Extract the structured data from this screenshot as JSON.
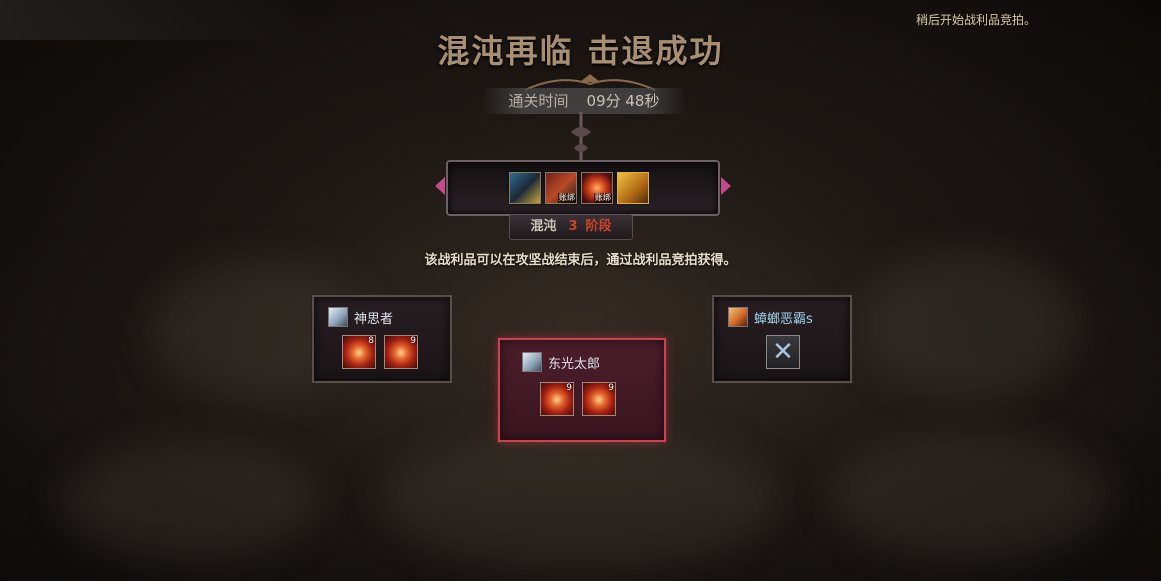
{
  "header": {
    "title_part1": "混沌再临",
    "title_part2": "击退成功",
    "clear_time_label": "通关时间",
    "clear_time_value": "09分 48秒",
    "notice": "稍后开始战利品竞拍。"
  },
  "loot": {
    "items": [
      {
        "icon": "treasure-chest-icon",
        "tag": ""
      },
      {
        "icon": "weapon-box-icon",
        "tag": "账绑"
      },
      {
        "icon": "red-orb-icon",
        "tag": "账绑"
      },
      {
        "icon": "golden-emblem-icon",
        "tag": ""
      }
    ],
    "stage_label": "混沌",
    "stage_number": "3",
    "stage_suffix": "阶段",
    "description": "该战利品可以在攻坚战结束后，通过战利品竞拍获得。"
  },
  "players": [
    {
      "name": "神思者",
      "items": [
        {
          "count": "8"
        },
        {
          "count": "9"
        }
      ]
    },
    {
      "name": "东光太郎",
      "items": [
        {
          "count": "9"
        },
        {
          "count": "9"
        }
      ]
    },
    {
      "name": "蟑螂恶霸s",
      "items": []
    }
  ],
  "colors": {
    "title": "#a88f72",
    "highlight_border": "#c84550",
    "stage_red": "#d0402a",
    "player_blue": "#9fd2ee"
  }
}
